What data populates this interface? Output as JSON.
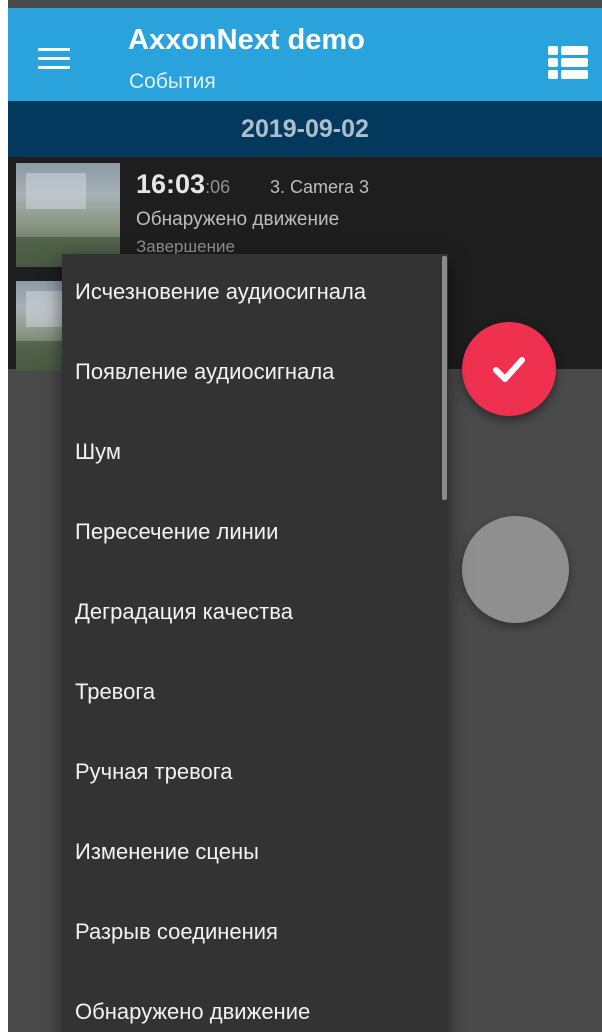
{
  "app_bar": {
    "title": "AxxonNext demo",
    "subtitle": "События",
    "menu_icon": "hamburger-menu-icon",
    "view_icon": "list-view-icon",
    "color": "#2aa3dc"
  },
  "date_header": {
    "date": "2019-09-02",
    "color": "#04395e"
  },
  "events": [
    {
      "time": "16:03",
      "seconds": ":06",
      "camera": "3. Camera 3",
      "type": "Обнаружено движение",
      "status": "Завершение"
    }
  ],
  "fab": {
    "confirm_icon": "checkmark-icon",
    "confirm_color": "#f0304f",
    "secondary_color": "#8f8f8f"
  },
  "dropdown": {
    "items": [
      "Исчезновение аудиосигнала",
      "Появление аудиосигнала",
      "Шум",
      "Пересечение линии",
      "Деградация качества",
      "Тревога",
      "Ручная тревога",
      "Изменение сцены",
      "Разрыв соединения",
      "Обнаружено движение"
    ]
  }
}
